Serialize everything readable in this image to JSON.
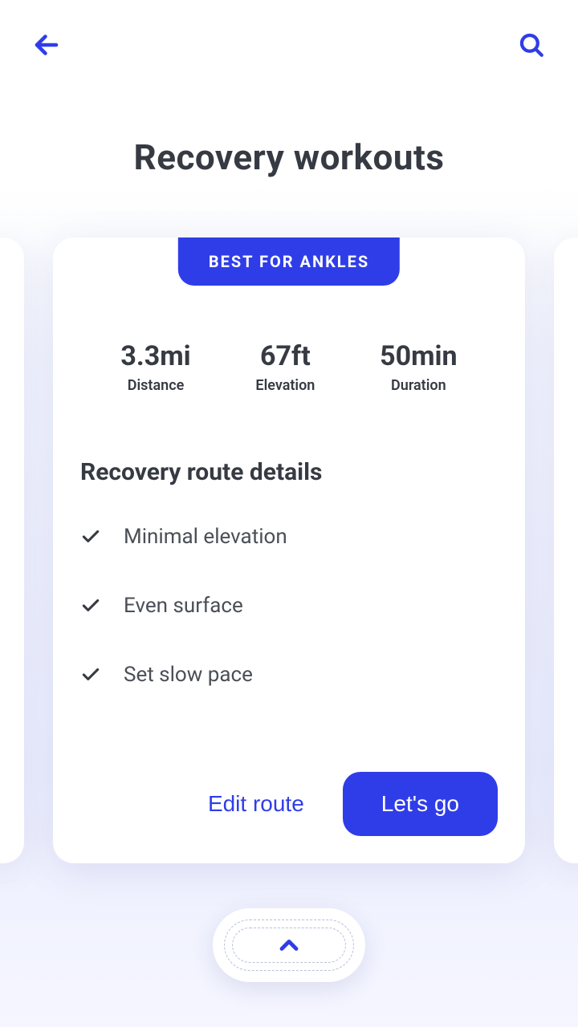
{
  "colors": {
    "accent": "#2f3de8",
    "text": "#363a42",
    "muted": "#4a4f57"
  },
  "header": {
    "title": "Recovery workouts"
  },
  "card": {
    "badge": "BEST FOR ANKLES",
    "stats": [
      {
        "value": "3.3mi",
        "label": "Distance"
      },
      {
        "value": "67ft",
        "label": "Elevation"
      },
      {
        "value": "50min",
        "label": "Duration"
      }
    ],
    "details_title": "Recovery route details",
    "features": [
      "Minimal elevation",
      "Even surface",
      "Set slow pace"
    ],
    "actions": {
      "edit": "Edit route",
      "go": "Let's go"
    }
  }
}
